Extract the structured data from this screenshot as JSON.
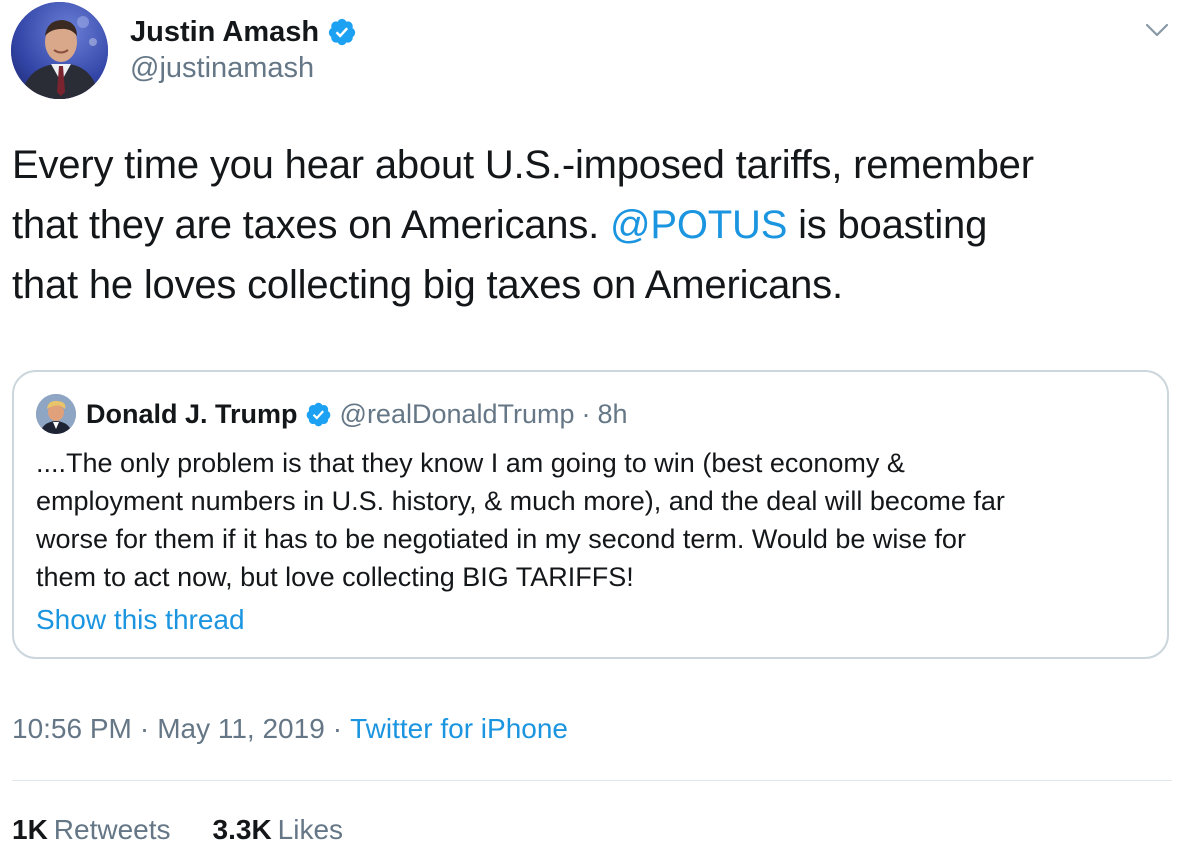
{
  "tweet": {
    "author": {
      "name": "Justin Amash",
      "handle": "@justinamash",
      "verified": true
    },
    "text_lines": [
      {
        "pre": "Every time you hear about U.S.-imposed tariffs, remember",
        "mention": "",
        "post": ""
      },
      {
        "pre": "that they are taxes on Americans. ",
        "mention": "@POTUS",
        "post": " is boasting"
      },
      {
        "pre": "that he loves collecting big taxes on Americans.",
        "mention": "",
        "post": ""
      }
    ],
    "menu_icon": "chevron-down-icon",
    "quoted": {
      "name": "Donald J. Trump",
      "handle": "@realDonaldTrump",
      "separator": "·",
      "time": "8h",
      "verified": true,
      "text_lines": [
        "....The only problem is that they know I am going to win (best economy &",
        "employment numbers in U.S. history, & much more), and the deal will become far",
        "worse for them if it has to be negotiated in my second term. Would be wise for",
        "them to act now, but love collecting BIG TARIFFS!"
      ],
      "show_thread": "Show this thread"
    },
    "meta": {
      "time": "10:56 PM",
      "separator": "·",
      "date": "May 11, 2019",
      "source": "Twitter for iPhone"
    },
    "stats": {
      "retweets_count": "1K",
      "retweets_label": "Retweets",
      "likes_count": "3.3K",
      "likes_label": "Likes"
    }
  },
  "colors": {
    "link": "#1b95e0",
    "secondary_text": "#657786",
    "primary_text": "#14171a",
    "border": "#ccd6dd",
    "verified": "#1da1f2"
  }
}
